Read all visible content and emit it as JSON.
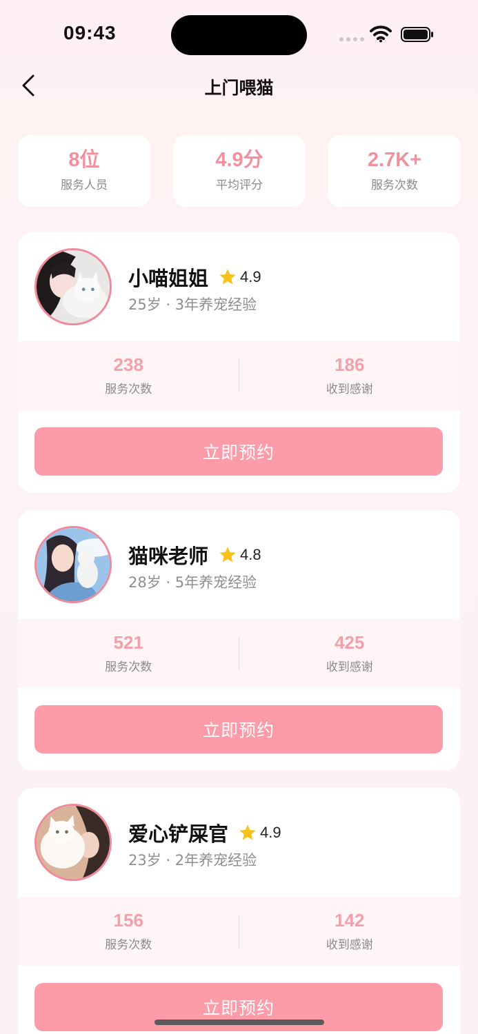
{
  "status_bar": {
    "time": "09:43"
  },
  "nav": {
    "title": "上门喂猫"
  },
  "summary": [
    {
      "value": "8位",
      "label": "服务人员"
    },
    {
      "value": "4.9分",
      "label": "平均评分"
    },
    {
      "value": "2.7K+",
      "label": "服务次数"
    }
  ],
  "staff": [
    {
      "name": "小喵姐姐",
      "rating": "4.9",
      "meta": "25岁 · 3年养宠经验",
      "stats": [
        {
          "value": "238",
          "label": "服务次数"
        },
        {
          "value": "186",
          "label": "收到感谢"
        }
      ],
      "button": "立即预约"
    },
    {
      "name": "猫咪老师",
      "rating": "4.8",
      "meta": "28岁 · 5年养宠经验",
      "stats": [
        {
          "value": "521",
          "label": "服务次数"
        },
        {
          "value": "425",
          "label": "收到感谢"
        }
      ],
      "button": "立即预约"
    },
    {
      "name": "爱心铲屎官",
      "rating": "4.9",
      "meta": "23岁 · 2年养宠经验",
      "stats": [
        {
          "value": "156",
          "label": "服务次数"
        },
        {
          "value": "142",
          "label": "收到感谢"
        }
      ],
      "button": "立即预约"
    }
  ],
  "colors": {
    "accent": "#fd9ba8",
    "stat_value": "#f3a0ab",
    "star": "#f7c21a"
  },
  "icons": {
    "back": "chevron-left-icon",
    "star": "star-icon",
    "wifi": "wifi-icon",
    "battery": "battery-icon"
  }
}
